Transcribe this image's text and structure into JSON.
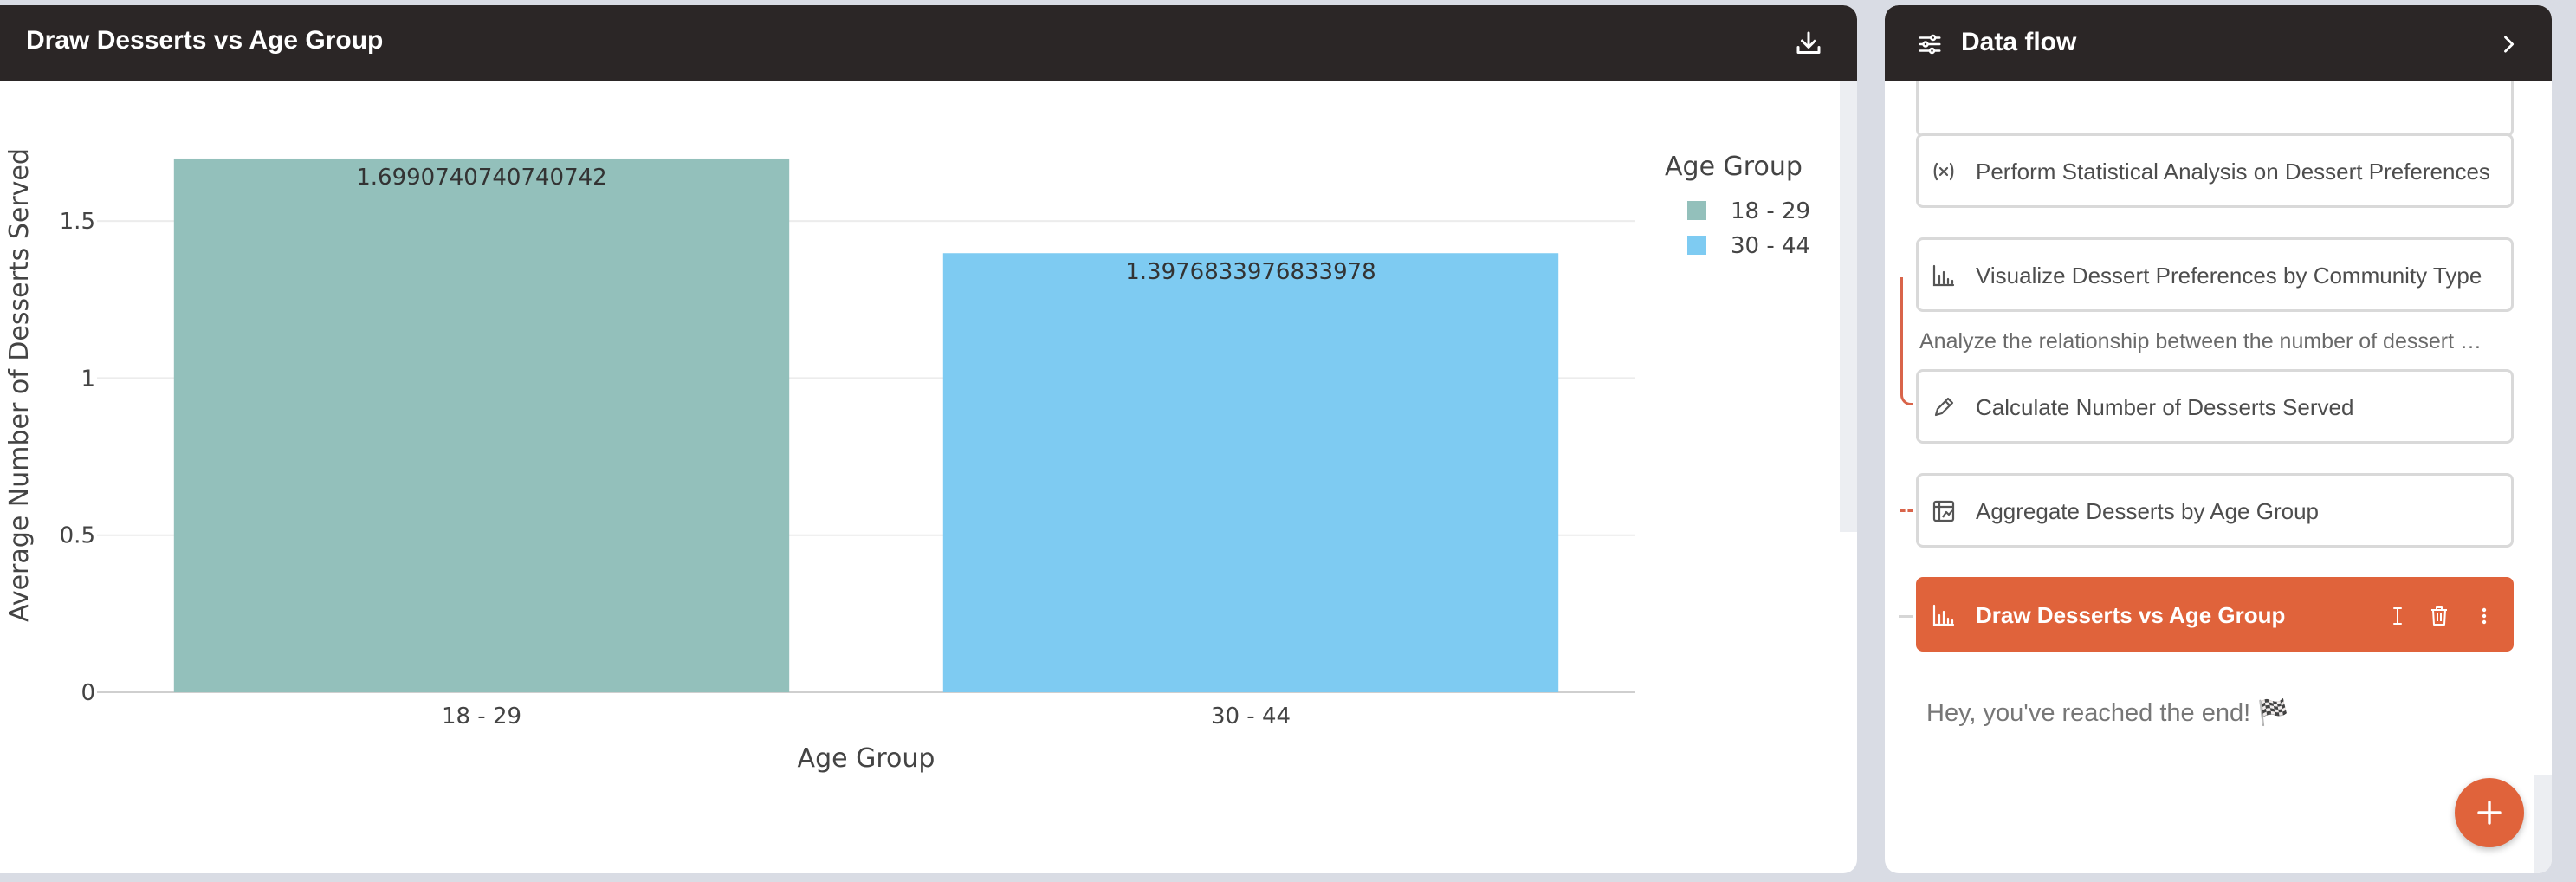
{
  "chart_panel": {
    "title": "Draw Desserts vs Age Group",
    "download_icon": "download-icon"
  },
  "chart_data": {
    "type": "bar",
    "categories": [
      "18 - 29",
      "30 - 44"
    ],
    "values": [
      1.6990740740740742,
      1.3976833976833978
    ],
    "value_labels": [
      "1.6990740740740742",
      "1.3976833976833978"
    ],
    "colors": [
      "#93c0bb",
      "#7ecbf2"
    ],
    "xlabel": "Age Group",
    "ylabel": "Average Number of Desserts Served",
    "ylim": [
      0,
      1.79
    ],
    "yticks": [
      0,
      0.5,
      1,
      1.5
    ],
    "ytick_labels": [
      "0",
      "0.5",
      "1",
      "1.5"
    ],
    "grid": true,
    "legend": {
      "title": "Age Group",
      "placement": "top-right",
      "entries": [
        "18 - 29",
        "30 - 44"
      ]
    }
  },
  "flow_panel": {
    "title": "Data flow",
    "header_icon": "flow-settings-icon",
    "collapse_icon": "chevron-right-icon",
    "steps": [
      {
        "label": "Perform Statistical Analysis on Dessert Preferences",
        "icon": "variable-icon"
      },
      {
        "label": "Visualize Dessert Preferences by Community Type",
        "icon": "bar-chart-icon"
      },
      {
        "label": "Calculate Number of Desserts Served",
        "icon": "pencil-icon"
      },
      {
        "label": "Aggregate Desserts by Age Group",
        "icon": "aggregate-icon"
      },
      {
        "label": "Draw Desserts vs Age Group",
        "icon": "bar-chart-icon"
      }
    ],
    "description": "Analyze the relationship between the number of dessert …",
    "end_text": "Hey, you've reached the end! 🏁",
    "add_icon": "plus-icon"
  }
}
